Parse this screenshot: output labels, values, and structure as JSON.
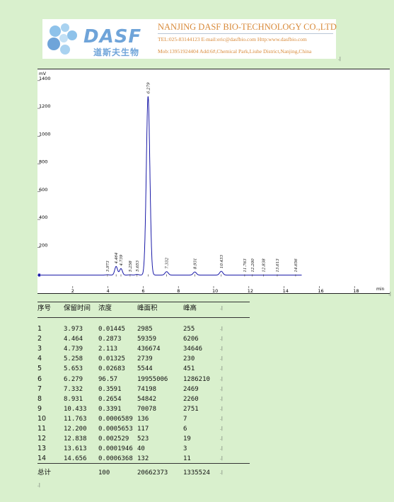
{
  "header": {
    "logo_text": "DASF",
    "logo_cn": "道斯夫生物",
    "company": "NANJING DASF BIO-TECHNOLOGY CO.,LTD",
    "contact_line": "TEL:025-83144123  E-mail:eric@dasfbio.com  Http:www.dasfbio.com",
    "address_line": "Mob:13951924404  Add:6#,Chemical Park,Liuhe District,Nanjing,China",
    "brand_color": "#6fa4d9",
    "text_color": "#d88a3a"
  },
  "chart_data": {
    "type": "line",
    "title": "",
    "ylabel": "mV",
    "xlabel": "min",
    "xlim": [
      0,
      20
    ],
    "ylim": [
      -130,
      1440
    ],
    "x_ticks": [
      2,
      4,
      6,
      8,
      10,
      12,
      14,
      16,
      18
    ],
    "y_ticks": [
      200,
      400,
      600,
      800,
      1000,
      1200,
      1400
    ],
    "y_tick_labels": [
      "200",
      "400",
      "600",
      "800",
      "1000",
      "1200",
      "1400"
    ],
    "peak_labels": [
      "3.973",
      "4.464",
      "4.739",
      "5.258",
      "5.653",
      "6.279",
      "7.332",
      "8.931",
      "10.433",
      "11.763",
      "12.200",
      "12.838",
      "13.613",
      "14.656"
    ],
    "peaks": [
      {
        "rt": 3.973,
        "height": 2.55
      },
      {
        "rt": 4.464,
        "height": 62.06
      },
      {
        "rt": 4.739,
        "height": 46.46
      },
      {
        "rt": 5.258,
        "height": 2.3
      },
      {
        "rt": 5.653,
        "height": 4.51
      },
      {
        "rt": 6.279,
        "height": 1286.21
      },
      {
        "rt": 7.332,
        "height": 24.69
      },
      {
        "rt": 8.931,
        "height": 22.6
      },
      {
        "rt": 10.433,
        "height": 27.51
      },
      {
        "rt": 11.763,
        "height": 0.07
      },
      {
        "rt": 12.2,
        "height": 0.06
      },
      {
        "rt": 12.838,
        "height": 0.19
      },
      {
        "rt": 13.613,
        "height": 0.03
      },
      {
        "rt": 14.656,
        "height": 0.11
      }
    ],
    "line_color": "#1a1aa8"
  },
  "table": {
    "headers": [
      "序号",
      "保留时间",
      "浓度",
      "峰面积",
      "峰高"
    ],
    "rows": [
      [
        "1",
        "3.973",
        "0.01445",
        "2985",
        "255"
      ],
      [
        "2",
        "4.464",
        "0.2873",
        "59359",
        "6206"
      ],
      [
        "3",
        "4.739",
        "2.113",
        "436674",
        "34646"
      ],
      [
        "4",
        "5.258",
        "0.01325",
        "2739",
        "230"
      ],
      [
        "5",
        "5.653",
        "0.02683",
        "5544",
        "451"
      ],
      [
        "6",
        "6.279",
        "96.57",
        "19955006",
        "1286210"
      ],
      [
        "7",
        "7.332",
        "0.3591",
        "74198",
        "2469"
      ],
      [
        "8",
        "8.931",
        "0.2654",
        "54842",
        "2260"
      ],
      [
        "9",
        "10.433",
        "0.3391",
        "70078",
        "2751"
      ],
      [
        "10",
        "11.763",
        "0.0006589",
        "136",
        "7"
      ],
      [
        "11",
        "12.200",
        "0.0005653",
        "117",
        "6"
      ],
      [
        "12",
        "12.838",
        "0.002529",
        "523",
        "19"
      ],
      [
        "13",
        "13.613",
        "0.0001946",
        "40",
        "3"
      ],
      [
        "14",
        "14.656",
        "0.0006368",
        "132",
        "11"
      ]
    ],
    "total": [
      "总计",
      "100",
      "20662373",
      "1335524"
    ],
    "para_mark": ".|"
  }
}
